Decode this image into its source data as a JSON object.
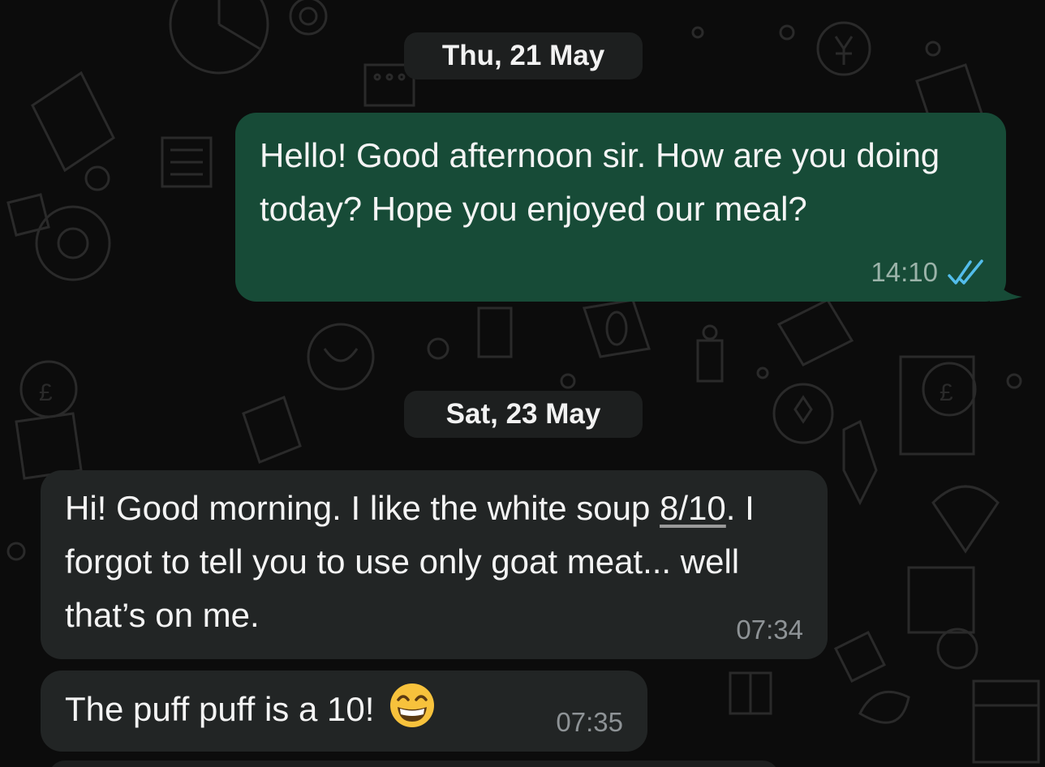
{
  "conversation": {
    "date_1": "Thu, 21 May",
    "date_2": "Sat, 23 May",
    "messages": [
      {
        "direction": "outgoing",
        "text": "Hello! Good afternoon sir. How are you doing today? Hope you enjoyed our meal?",
        "time": "14:10",
        "status": "read",
        "status_icon": "double-check-icon",
        "status_color": "#53bdeb"
      },
      {
        "direction": "incoming",
        "text_before_link": "Hi! Good morning. I like the white soup ",
        "link_text": "8/10",
        "text_after_link": ". I forgot to tell you to use only goat meat... well that’s on me.",
        "time": "07:34"
      },
      {
        "direction": "incoming",
        "text": "The puff puff is a 10!",
        "emoji": "grinning-face-with-smiling-eyes",
        "time": "07:35"
      }
    ]
  },
  "colors": {
    "background": "#0c0c0c",
    "outgoing_bubble": "#174b37",
    "incoming_bubble": "#222525",
    "date_pill": "#1d1f1f",
    "read_ticks": "#53bdeb"
  }
}
